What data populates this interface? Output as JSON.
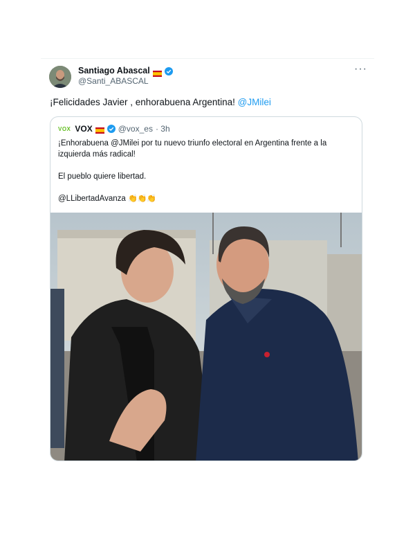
{
  "tweet": {
    "author_name": "Santiago Abascal",
    "author_handle": "@Santi_ABASCAL",
    "more_label": "···",
    "text": "¡Felicidades Javier , enhorabuena Argentina! ",
    "mention": "@JMilei"
  },
  "quote": {
    "logo_text": "VOX",
    "name": "VOX",
    "handle": "@vox_es",
    "time": "· 3h",
    "line1": "¡Enhorabuena @JMilei por tu nuevo triunfo electoral en Argentina frente a la izquierda más radical!",
    "line2": "El pueblo quiere libertad.",
    "line3": "@LLibertadAvanza",
    "claps": "👏👏👏"
  },
  "colors": {
    "accent": "#1d9bf0",
    "text": "#0f1419",
    "muted": "#536471",
    "vox_green": "#63be21"
  },
  "icons": [
    "spain-flag-icon",
    "verified-badge-icon",
    "more-options-icon",
    "vox-logo-icon"
  ]
}
